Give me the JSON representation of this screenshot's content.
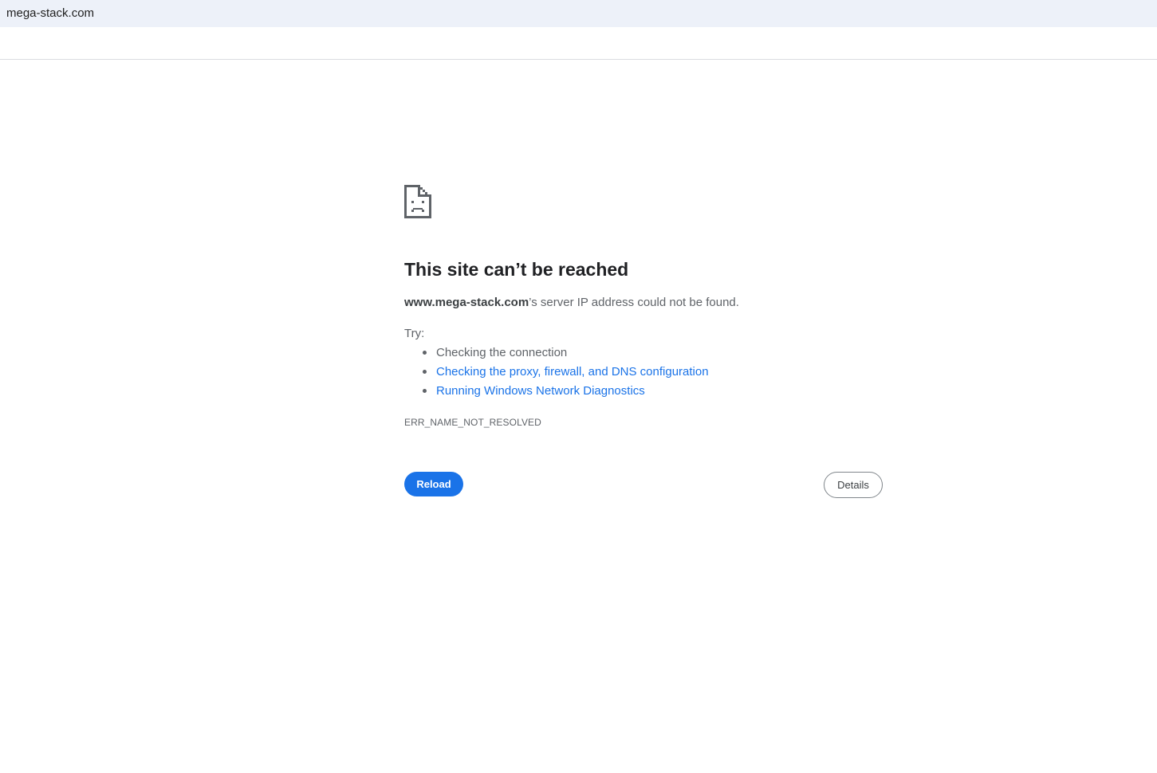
{
  "address_bar": {
    "url": "mega-stack.com"
  },
  "error_page": {
    "icon": "sad-document-icon",
    "title": "This site can’t be reached",
    "summary": {
      "host": "www.mega-stack.com",
      "message": "’s server IP address could not be found."
    },
    "try_label": "Try:",
    "suggestions": [
      {
        "label": "Checking the connection",
        "is_link": false
      },
      {
        "label": "Checking the proxy, firewall, and DNS configuration",
        "is_link": true
      },
      {
        "label": "Running Windows Network Diagnostics",
        "is_link": true
      }
    ],
    "error_code": "ERR_NAME_NOT_RESOLVED",
    "reload_label": "Reload",
    "details_label": "Details"
  },
  "colors": {
    "accent": "#1a73e8",
    "address_bar_bg": "#edf1f9",
    "text_secondary": "#5f6368"
  }
}
